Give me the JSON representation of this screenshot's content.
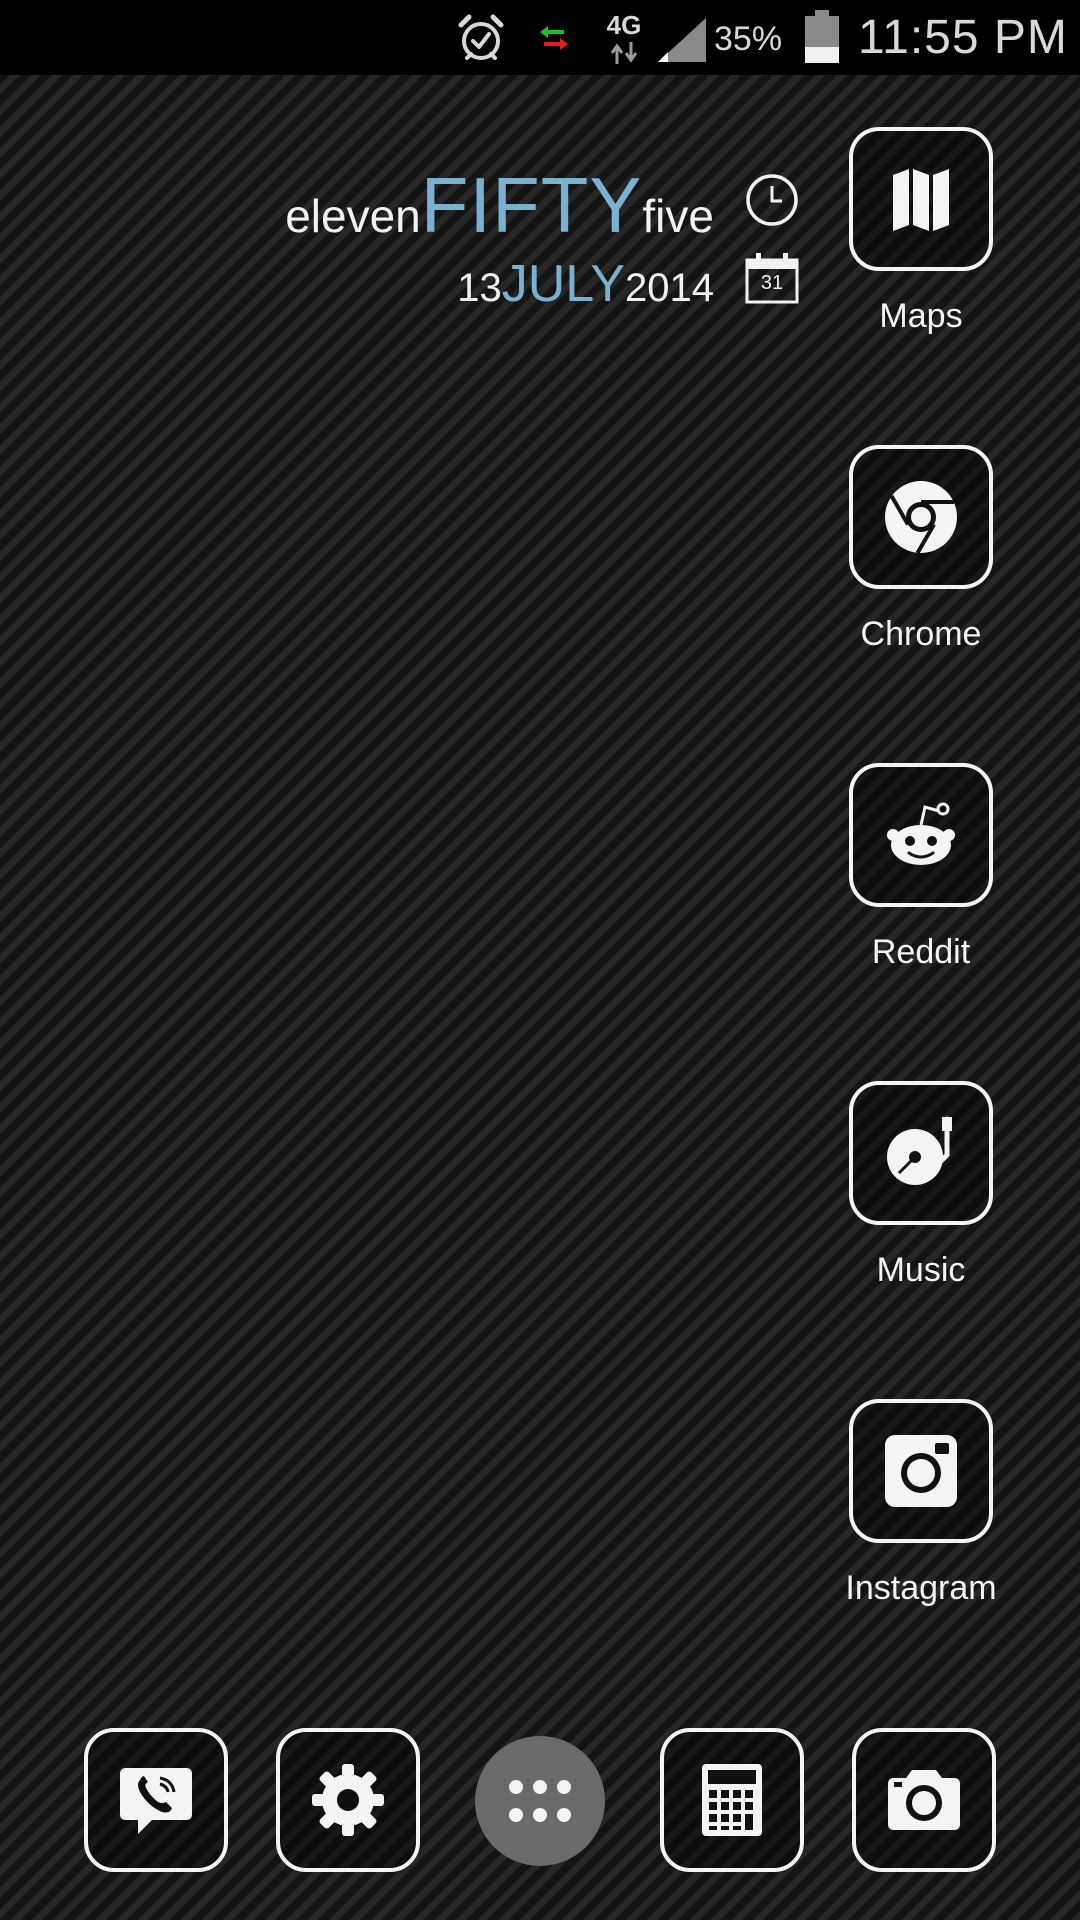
{
  "status_bar": {
    "alarm_icon": "alarm-clock-icon",
    "sync_icon": "data-sync-arrows-icon",
    "network_type": "4G",
    "signal_icon": "cell-signal-icon",
    "battery_percent": "35%",
    "battery_level": 0.35,
    "time": "11:55 PM"
  },
  "clock_widget": {
    "hour_word": "eleven",
    "minute_tens_word": "FIFTY",
    "minute_ones_word": "five",
    "day": "13",
    "month": "JULY",
    "year": "2014",
    "calendar_icon_day": "31",
    "accent_color": "#7ab1cf"
  },
  "apps": [
    {
      "label": "Maps",
      "icon": "map-icon"
    },
    {
      "label": "Chrome",
      "icon": "chrome-icon"
    },
    {
      "label": "Reddit",
      "icon": "reddit-alien-icon"
    },
    {
      "label": "Music",
      "icon": "turntable-icon"
    },
    {
      "label": "Instagram",
      "icon": "instagram-camera-icon"
    }
  ],
  "dock": [
    {
      "icon": "viber-phone-icon"
    },
    {
      "icon": "gear-icon"
    },
    {
      "icon": "app-drawer-icon"
    },
    {
      "icon": "calculator-icon"
    },
    {
      "icon": "camera-icon"
    }
  ],
  "colors": {
    "icon_outline": "#f4f4f4",
    "status_bar_bg": "#000000",
    "app_drawer_bg": "#6a6a6a"
  }
}
